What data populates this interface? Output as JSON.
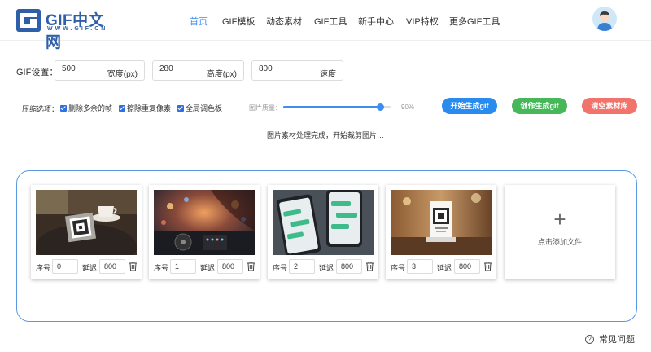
{
  "header": {
    "logo_text": "GIF中文网",
    "logo_sub": "WWW.GIF.CN",
    "nav": [
      {
        "label": "首页",
        "active": true
      },
      {
        "label": "GIF模板",
        "active": false
      },
      {
        "label": "动态素材",
        "active": false
      },
      {
        "label": "GIF工具",
        "active": false
      },
      {
        "label": "新手中心",
        "active": false
      },
      {
        "label": "VIP特权",
        "active": false
      },
      {
        "label": "更多GIF工具",
        "active": false
      }
    ],
    "avatar_icon": "user-avatar-icon"
  },
  "settings": {
    "label": "GIF设置：",
    "fields": [
      {
        "value": "500",
        "unit": "宽度(px)"
      },
      {
        "value": "280",
        "unit": "高度(px)"
      },
      {
        "value": "800",
        "unit": "速度"
      }
    ]
  },
  "compression": {
    "label": "压缩选项：",
    "options": [
      {
        "label": "删除多余的帧",
        "checked": true
      },
      {
        "label": "擦除重复像素",
        "checked": true
      },
      {
        "label": "全局调色板",
        "checked": true
      }
    ],
    "quality_label": "图片质量：",
    "quality_value": "90%",
    "quality_level": 0.9
  },
  "buttons": {
    "start": "开始生成gif",
    "create": "创作生成gif",
    "clear": "清空素材库"
  },
  "colors": {
    "accent": "#3d8ef0",
    "start": "#2a8bef",
    "create": "#46b85a",
    "clear": "#f2736b",
    "border": "#5a98e0"
  },
  "status": "图片素材处理完成，开始裁剪图片…",
  "frames": [
    {
      "index_label": "序号",
      "index": "0",
      "delay_label": "延迟",
      "delay": "800",
      "image": "cafe-qr-code"
    },
    {
      "index_label": "序号",
      "index": "1",
      "delay_label": "延迟",
      "delay": "800",
      "image": "dj-mixer"
    },
    {
      "index_label": "序号",
      "index": "2",
      "delay_label": "延迟",
      "delay": "800",
      "image": "phones-chat"
    },
    {
      "index_label": "序号",
      "index": "3",
      "delay_label": "延迟",
      "delay": "800",
      "image": "qr-stand"
    }
  ],
  "add_file": {
    "plus": "+",
    "label": "点击添加文件"
  },
  "faq": "常见问题"
}
